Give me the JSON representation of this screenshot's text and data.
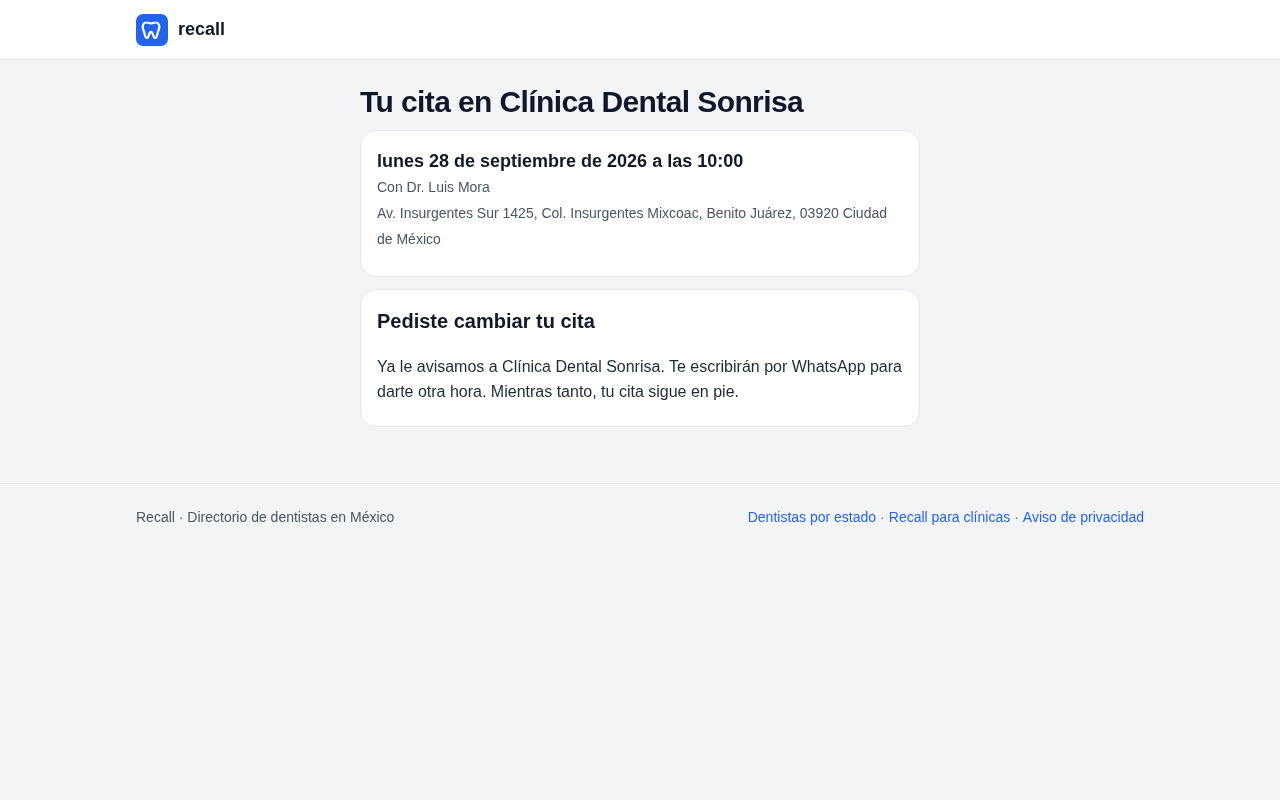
{
  "header": {
    "brand": "recall"
  },
  "page_title": "Tu cita en Clínica Dental Sonrisa",
  "appointment_card": {
    "datetime": "lunes 28 de septiembre de 2026 a las 10:00",
    "dentist": "Con Dr. Luis Mora",
    "address": "Av. Insurgentes Sur 1425, Col. Insurgentes Mixcoac, Benito Juárez, 03920 Ciudad de México"
  },
  "status_card": {
    "title": "Pediste cambiar tu cita",
    "message": "Ya le avisamos a Clínica Dental Sonrisa. Te escribirán por WhatsApp para darte otra hora. Mientras tanto, tu cita sigue en pie."
  },
  "footer": {
    "tagline": "Recall · Directorio de dentistas en México",
    "separator": "·",
    "links": [
      {
        "label": "Dentistas por estado"
      },
      {
        "label": "Recall para clínicas"
      },
      {
        "label": "Aviso de privacidad"
      }
    ]
  }
}
